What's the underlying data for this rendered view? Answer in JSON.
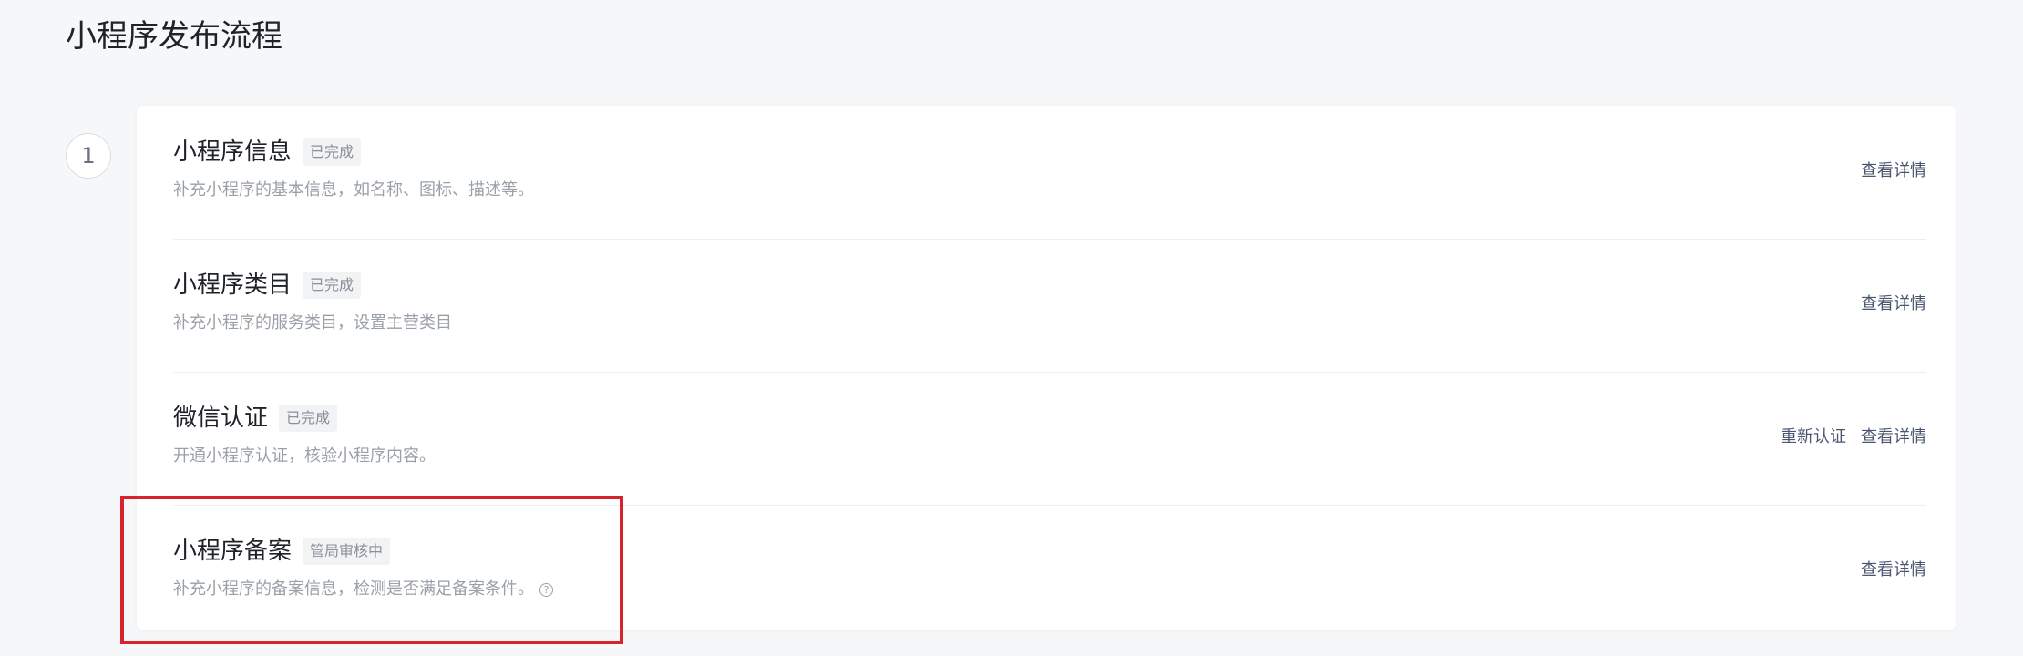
{
  "page": {
    "title": "小程序发布流程"
  },
  "step": {
    "number": "1"
  },
  "rows": [
    {
      "title": "小程序信息",
      "badge": "已完成",
      "desc": "补充小程序的基本信息，如名称、图标、描述等。",
      "actions": [
        "查看详情"
      ]
    },
    {
      "title": "小程序类目",
      "badge": "已完成",
      "desc": "补充小程序的服务类目，设置主营类目",
      "actions": [
        "查看详情"
      ]
    },
    {
      "title": "微信认证",
      "badge": "已完成",
      "desc": "开通小程序认证，核验小程序内容。",
      "actions": [
        "重新认证",
        "查看详情"
      ]
    },
    {
      "title": "小程序备案",
      "badge": "管局审核中",
      "desc": "补充小程序的备案信息，检测是否满足备案条件。",
      "actions": [
        "查看详情"
      ],
      "help_icon": "question-circle-icon",
      "help_glyph": "?"
    }
  ],
  "colors": {
    "accent_highlight": "#d6232e",
    "link": "#4a5670",
    "badge_bg": "#f2f3f5"
  }
}
